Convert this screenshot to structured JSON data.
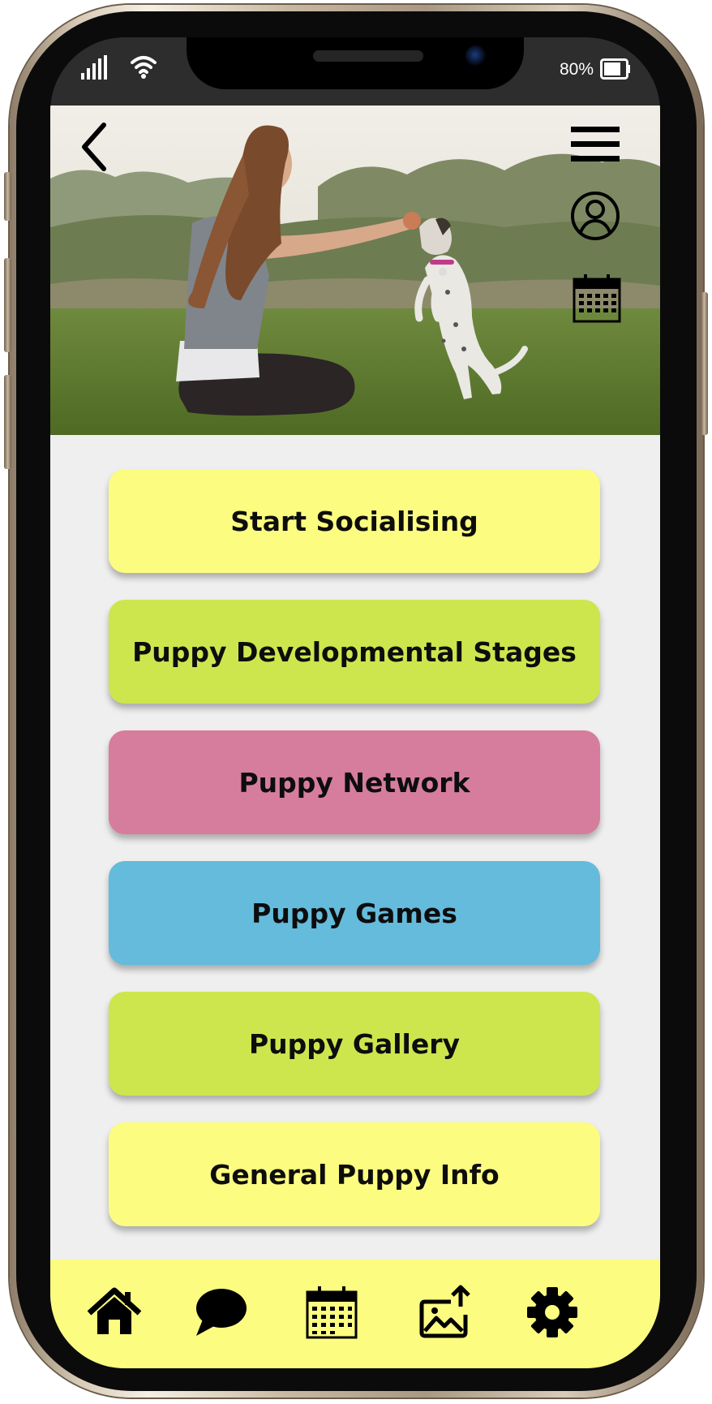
{
  "status_bar": {
    "battery_percent": "80%",
    "icons": [
      "signal-icon",
      "wifi-icon",
      "battery-icon"
    ]
  },
  "header": {
    "icons": [
      "back-arrow-icon",
      "hamburger-menu-icon",
      "user-profile-icon",
      "calendar-icon"
    ]
  },
  "hero": {
    "image": "girl-training-puppy-photo"
  },
  "menu": {
    "items": [
      {
        "label": "Start Socialising",
        "color": "#fcfc80"
      },
      {
        "label": "Puppy Developmental Stages",
        "color": "#cde64e"
      },
      {
        "label": "Puppy Network",
        "color": "#d67d9d"
      },
      {
        "label": "Puppy Games",
        "color": "#64bbdc"
      },
      {
        "label": "Puppy Gallery",
        "color": "#cde64e"
      },
      {
        "label": "General Puppy Info",
        "color": "#fcfc80"
      }
    ]
  },
  "bottom_nav": {
    "background": "#fcfc80",
    "items": [
      "home-icon",
      "chat-bubble-icon",
      "calendar-icon",
      "image-upload-icon",
      "settings-gear-icon"
    ]
  },
  "colors": {
    "app_background": "#efefef",
    "status_bar": "#2d2d2d",
    "text": "#0d0d0d"
  }
}
